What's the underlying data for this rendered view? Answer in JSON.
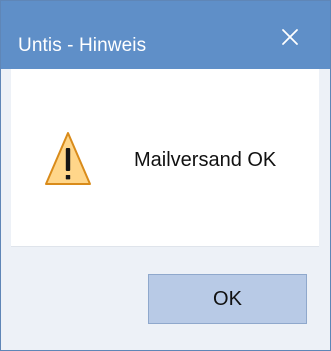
{
  "window": {
    "title": "Untis - Hinweis",
    "close_icon": "close-icon"
  },
  "message": {
    "icon": "warning-icon",
    "text": "Mailversand OK"
  },
  "buttons": {
    "ok_label": "OK"
  },
  "colors": {
    "titlebar": "#5f8fc8",
    "dialog_background": "#edf1f7",
    "content_background": "#ffffff",
    "ok_button": "#b8cae6",
    "warning_fill": "#ffd68a",
    "warning_stroke": "#d98b1a"
  }
}
